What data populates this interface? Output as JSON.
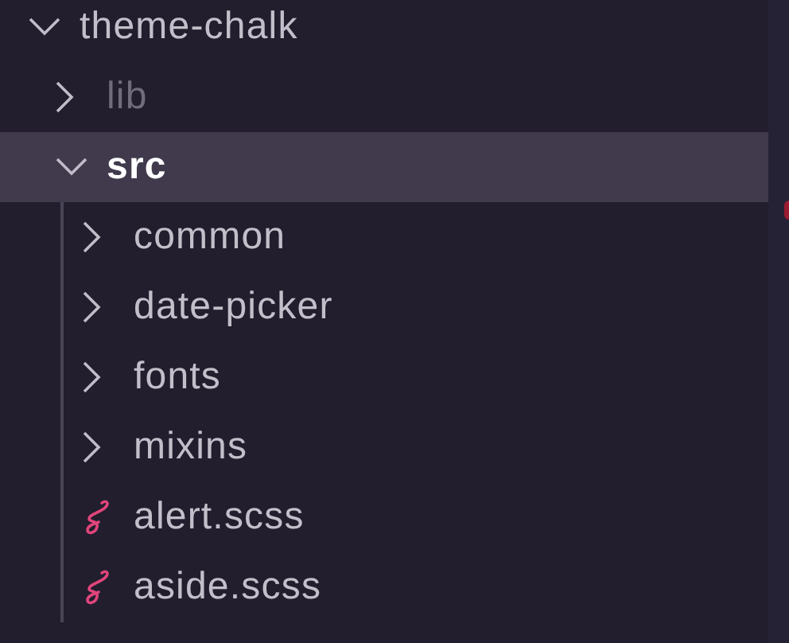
{
  "tree": [
    {
      "name": "theme-chalk",
      "kind": "folder",
      "expanded": true,
      "selected": false,
      "ignored": false,
      "children": [
        {
          "name": "lib",
          "kind": "folder",
          "expanded": false,
          "selected": false,
          "ignored": true
        },
        {
          "name": "src",
          "kind": "folder",
          "expanded": true,
          "selected": true,
          "ignored": false,
          "children": [
            {
              "name": "common",
              "kind": "folder",
              "expanded": false,
              "selected": false,
              "ignored": false
            },
            {
              "name": "date-picker",
              "kind": "folder",
              "expanded": false,
              "selected": false,
              "ignored": false
            },
            {
              "name": "fonts",
              "kind": "folder",
              "expanded": false,
              "selected": false,
              "ignored": false
            },
            {
              "name": "mixins",
              "kind": "folder",
              "expanded": false,
              "selected": false,
              "ignored": false
            },
            {
              "name": "alert.scss",
              "kind": "scss",
              "selected": false,
              "ignored": false
            },
            {
              "name": "aside.scss",
              "kind": "scss",
              "selected": false,
              "ignored": false
            }
          ]
        }
      ]
    }
  ]
}
